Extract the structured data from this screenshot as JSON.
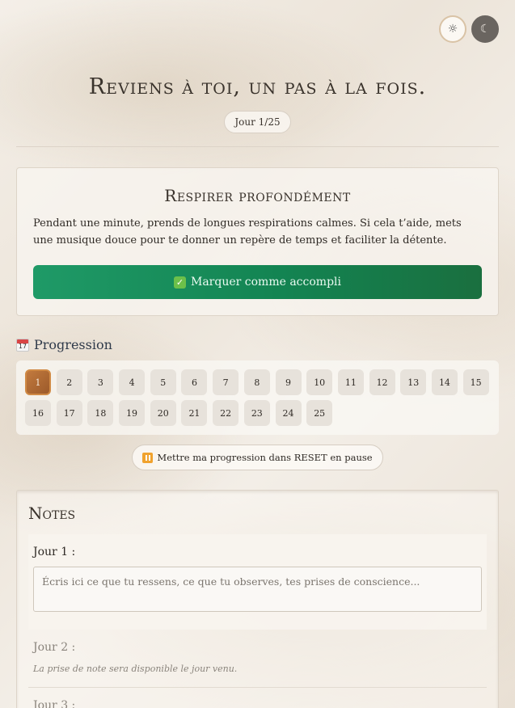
{
  "theme": {
    "light_icon": "☼",
    "dark_icon": "☾"
  },
  "header": {
    "title": "Reviens à toi, un pas à la fois.",
    "day_badge": "Jour 1/25"
  },
  "task": {
    "title": "Respirer profondément",
    "description": "Pendant une minute, prends de longues respirations calmes. Si cela t’aide, mets une musique douce pour te donner un repère de temps et faciliter la détente.",
    "done_icon": "✓",
    "done_label": "Marquer comme accompli"
  },
  "progress": {
    "heading": "Progression",
    "calendar_icon_text": "17",
    "current_day": 1,
    "days": [
      "1",
      "2",
      "3",
      "4",
      "5",
      "6",
      "7",
      "8",
      "9",
      "10",
      "11",
      "12",
      "13",
      "14",
      "15",
      "16",
      "17",
      "18",
      "19",
      "20",
      "21",
      "22",
      "23",
      "24",
      "25"
    ]
  },
  "pause": {
    "label": "Mettre ma progression dans RESET en pause"
  },
  "notes": {
    "title": "Notes",
    "entries": [
      {
        "label": "Jour 1 :",
        "placeholder": "Écris ici ce que tu ressens, ce que tu observes, tes prises de conscience..."
      },
      {
        "label": "Jour 2 :",
        "locked_message": "La prise de note sera disponible le jour venu."
      },
      {
        "label": "Jour 3 :"
      }
    ]
  },
  "colors": {
    "accent_green": "#138452",
    "current_day": "#b06a33",
    "pause_orange": "#f0a22e"
  }
}
